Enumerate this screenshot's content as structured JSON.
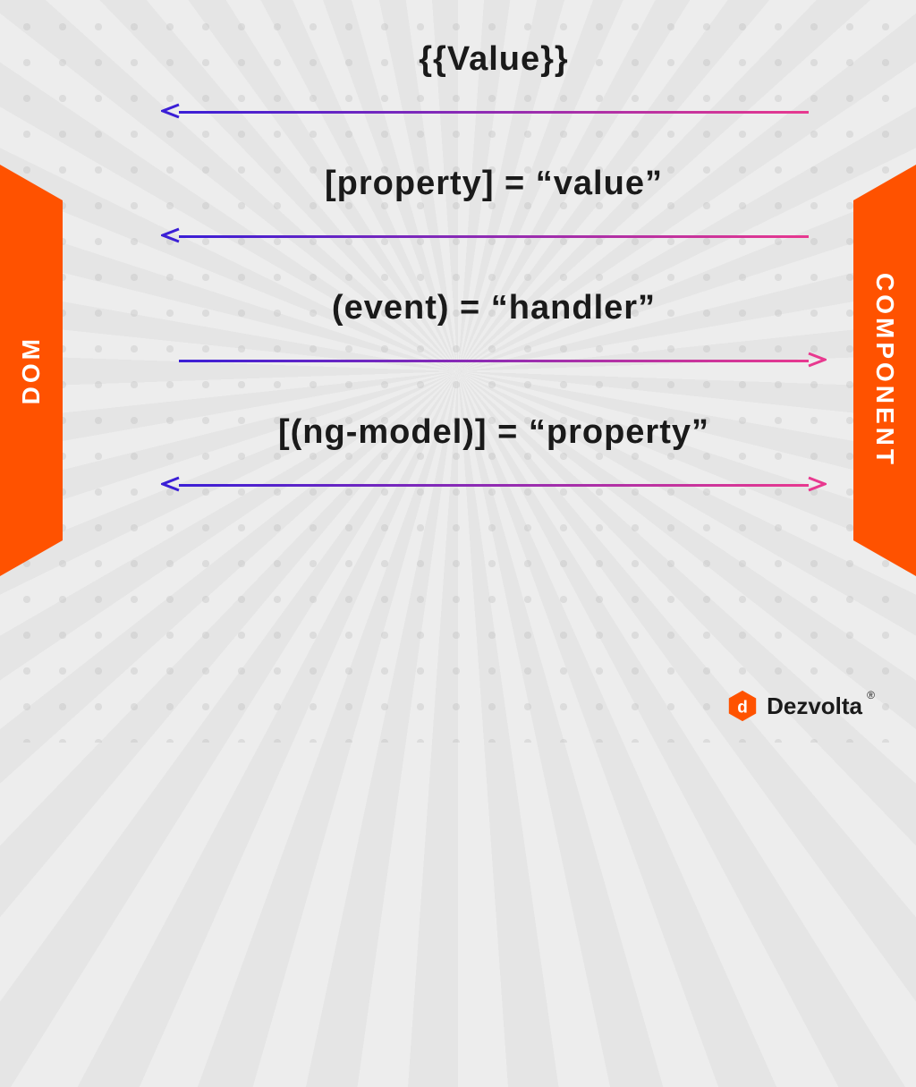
{
  "sideLabels": {
    "left": "DOM",
    "right": "COMPONENT"
  },
  "bindings": [
    {
      "label": "{{Value}}",
      "arrowLeft": true,
      "arrowRight": false
    },
    {
      "label": "[property] = “value”",
      "arrowLeft": true,
      "arrowRight": false
    },
    {
      "label": "(event) = “handler”",
      "arrowLeft": false,
      "arrowRight": true
    },
    {
      "label": "[(ng-model)] = “property”",
      "arrowLeft": true,
      "arrowRight": true
    }
  ],
  "brand": {
    "name": "Dezvolta",
    "registered": "®"
  },
  "colors": {
    "orange": "#ff5200",
    "arrowStart": "#3b1fd6",
    "arrowEnd": "#e8398f"
  }
}
